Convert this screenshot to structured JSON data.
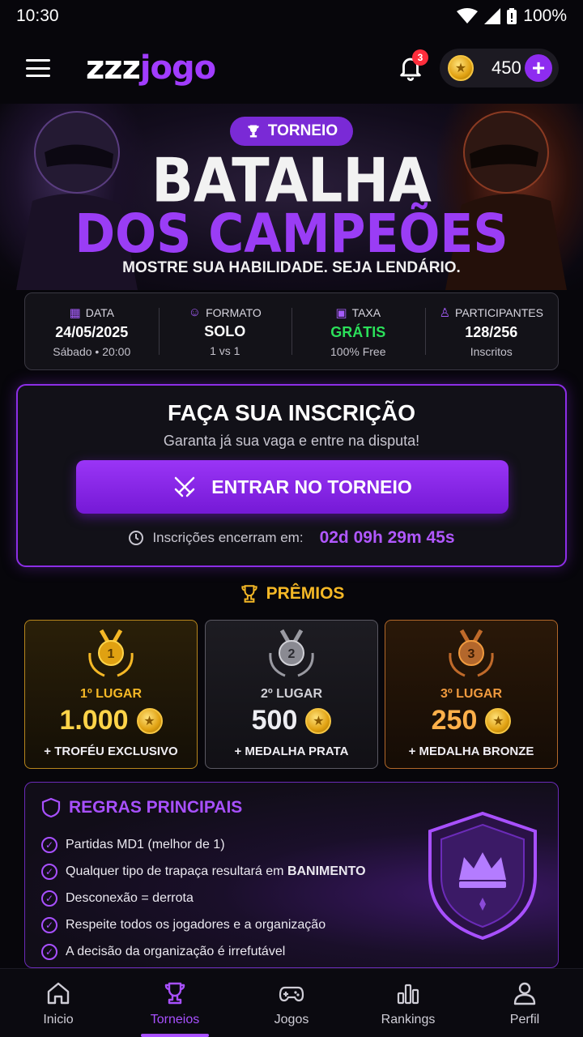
{
  "status_bar": {
    "time": "10:30",
    "battery": "100%"
  },
  "header": {
    "logo_a": "zzz",
    "logo_b": "jogo",
    "notification_count": "3",
    "coin_balance": "450",
    "add_label": "+"
  },
  "banner": {
    "tag": "TORNEIO",
    "title_line1": "BATALHA",
    "title_line2": "DOS CAMPEÕES",
    "tagline": "MOSTRE SUA HABILIDADE. SEJA LENDÁRIO."
  },
  "info": [
    {
      "label": "DATA",
      "icon": "calendar-icon",
      "value": "24/05/2025",
      "sub": "Sábado • 20:00"
    },
    {
      "label": "FORMATO",
      "icon": "users-icon",
      "value": "SOLO",
      "sub": "1 vs 1"
    },
    {
      "label": "TAXA",
      "icon": "ticket-icon",
      "value": "GRÁTIS",
      "sub": "100% Free"
    },
    {
      "label": "PARTICIPANTES",
      "icon": "user-icon",
      "value": "128/256",
      "sub": "Inscritos"
    }
  ],
  "signup": {
    "title": "FAÇA SUA INSCRIÇÃO",
    "subtitle": "Garanta já sua vaga e entre na disputa!",
    "button": "ENTRAR NO TORNEIO",
    "countdown_label": "Inscrições encerram em:",
    "countdown_value": "02d 09h 29m 45s"
  },
  "prizes": {
    "title": "PRÊMIOS",
    "items": [
      {
        "medal": "1",
        "place": "1º LUGAR",
        "amount": "1.000",
        "extra": "+ TROFÉU EXCLUSIVO",
        "color": "#f5b826"
      },
      {
        "medal": "2",
        "place": "2º LUGAR",
        "amount": "500",
        "extra": "+ MEDALHA PRATA",
        "color": "#c8c8d0"
      },
      {
        "medal": "3",
        "place": "3º LUGAR",
        "amount": "250",
        "extra": "+ MEDALHA BRONZE",
        "color": "#e0823a"
      }
    ]
  },
  "rules": {
    "title": "REGRAS PRINCIPAIS",
    "items": [
      {
        "text": "Partidas MD1 (melhor de 1)",
        "bold": ""
      },
      {
        "text": "Qualquer tipo de trapaça resultará em ",
        "bold": "BANIMENTO"
      },
      {
        "text": "Desconexão = derrota",
        "bold": ""
      },
      {
        "text": "Respeite todos os jogadores e a organização",
        "bold": ""
      },
      {
        "text": "A decisão da organização é irrefutável",
        "bold": ""
      }
    ]
  },
  "nav": [
    {
      "label": "Inicio",
      "icon": "home-icon",
      "active": false
    },
    {
      "label": "Torneios",
      "icon": "trophy-icon",
      "active": true
    },
    {
      "label": "Jogos",
      "icon": "gamepad-icon",
      "active": false
    },
    {
      "label": "Rankings",
      "icon": "bar-chart-icon",
      "active": false
    },
    {
      "label": "Perfil",
      "icon": "profile-icon",
      "active": false
    }
  ],
  "colors": {
    "accent": "#a850ff",
    "gold": "#f5b826",
    "green": "#2be05a",
    "button": "#8e2cf0"
  }
}
